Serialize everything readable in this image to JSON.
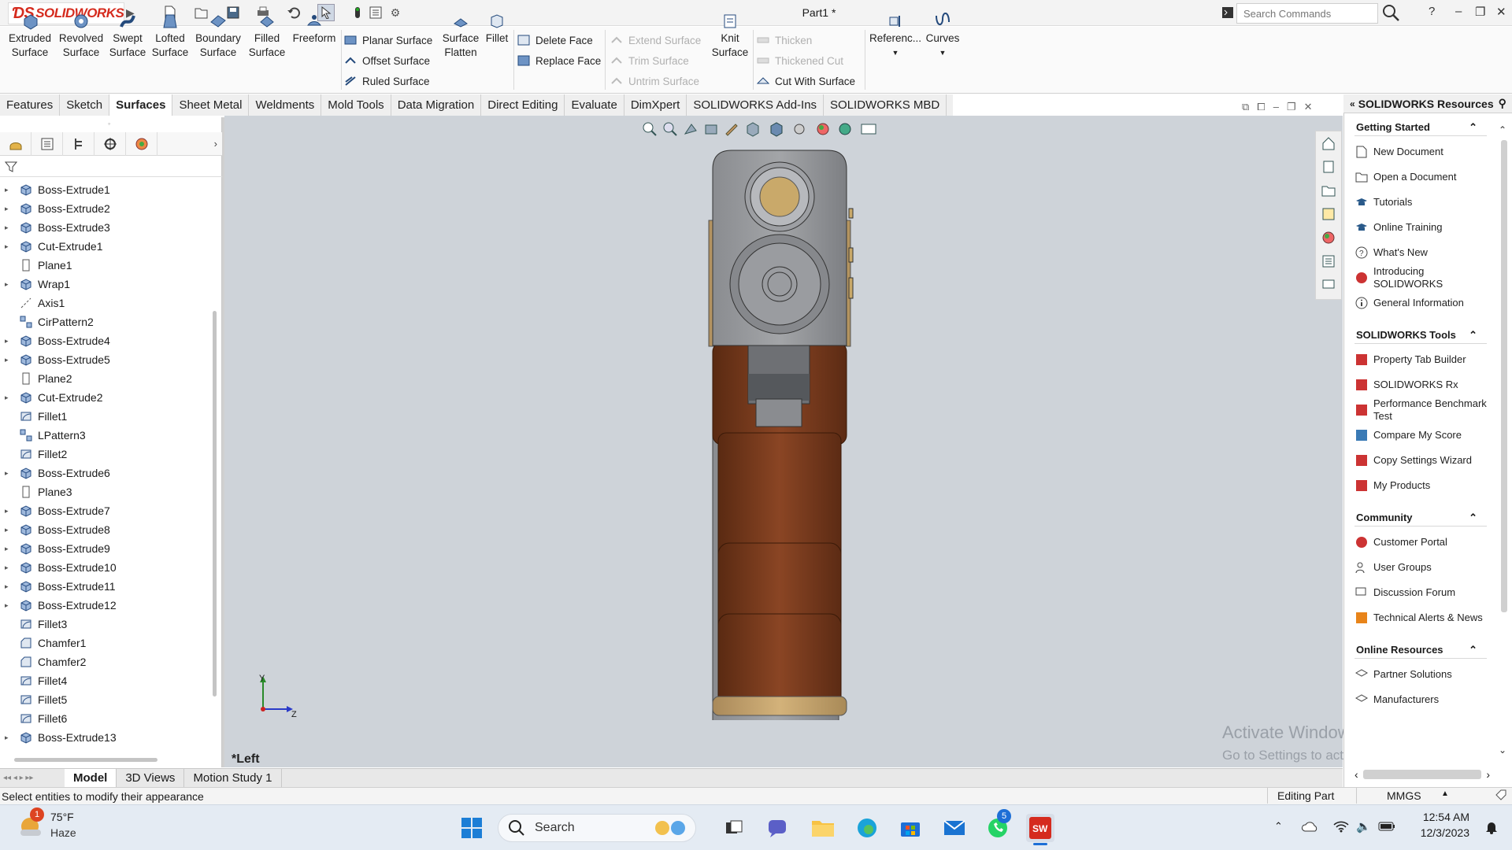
{
  "titlebar": {
    "app_name": "SOLIDWORKS",
    "doc_title": "Part1 *",
    "search_placeholder": "Search Commands",
    "help_label": "?"
  },
  "command_manager": {
    "big_buttons": [
      {
        "label": "Extruded Surface"
      },
      {
        "label": "Revolved Surface"
      },
      {
        "label": "Swept Surface"
      },
      {
        "label": "Lofted Surface"
      },
      {
        "label": "Boundary Surface"
      },
      {
        "label": "Filled Surface"
      },
      {
        "label": "Freeform"
      }
    ],
    "group1": [
      "Planar Surface",
      "Offset Surface",
      "Ruled Surface"
    ],
    "surface_flatten": "Surface Flatten",
    "fillet": "Fillet",
    "group2": [
      "Delete Face",
      "Replace Face"
    ],
    "group3_disabled": [
      "Extend Surface",
      "Trim Surface",
      "Untrim Surface"
    ],
    "knit": "Knit Surface",
    "group4": [
      "Thicken",
      "Thickened Cut",
      "Cut With Surface"
    ],
    "reference": "Referenc...",
    "curves": "Curves",
    "tabs": [
      "Features",
      "Sketch",
      "Surfaces",
      "Sheet Metal",
      "Weldments",
      "Mold Tools",
      "Data Migration",
      "Direct Editing",
      "Evaluate",
      "DimXpert",
      "SOLIDWORKS Add-Ins",
      "SOLIDWORKS MBD"
    ],
    "active_tab": "Surfaces"
  },
  "feature_tree": {
    "items": [
      {
        "name": "Boss-Extrude1",
        "type": "extrude",
        "expandable": true
      },
      {
        "name": "Boss-Extrude2",
        "type": "extrude",
        "expandable": true
      },
      {
        "name": "Boss-Extrude3",
        "type": "extrude",
        "expandable": true
      },
      {
        "name": "Cut-Extrude1",
        "type": "extrude",
        "expandable": true
      },
      {
        "name": "Plane1",
        "type": "plane",
        "expandable": false
      },
      {
        "name": "Wrap1",
        "type": "extrude",
        "expandable": true
      },
      {
        "name": "Axis1",
        "type": "axis",
        "expandable": false
      },
      {
        "name": "CirPattern2",
        "type": "pattern",
        "expandable": false
      },
      {
        "name": "Boss-Extrude4",
        "type": "extrude",
        "expandable": true
      },
      {
        "name": "Boss-Extrude5",
        "type": "extrude",
        "expandable": true
      },
      {
        "name": "Plane2",
        "type": "plane",
        "expandable": false
      },
      {
        "name": "Cut-Extrude2",
        "type": "extrude",
        "expandable": true
      },
      {
        "name": "Fillet1",
        "type": "fillet",
        "expandable": false
      },
      {
        "name": "LPattern3",
        "type": "pattern",
        "expandable": false
      },
      {
        "name": "Fillet2",
        "type": "fillet",
        "expandable": false
      },
      {
        "name": "Boss-Extrude6",
        "type": "extrude",
        "expandable": true
      },
      {
        "name": "Plane3",
        "type": "plane",
        "expandable": false
      },
      {
        "name": "Boss-Extrude7",
        "type": "extrude",
        "expandable": true
      },
      {
        "name": "Boss-Extrude8",
        "type": "extrude",
        "expandable": true
      },
      {
        "name": "Boss-Extrude9",
        "type": "extrude",
        "expandable": true
      },
      {
        "name": "Boss-Extrude10",
        "type": "extrude",
        "expandable": true
      },
      {
        "name": "Boss-Extrude11",
        "type": "extrude",
        "expandable": true
      },
      {
        "name": "Boss-Extrude12",
        "type": "extrude",
        "expandable": true
      },
      {
        "name": "Fillet3",
        "type": "fillet",
        "expandable": false
      },
      {
        "name": "Chamfer1",
        "type": "chamfer",
        "expandable": false
      },
      {
        "name": "Chamfer2",
        "type": "chamfer",
        "expandable": false
      },
      {
        "name": "Fillet4",
        "type": "fillet",
        "expandable": false
      },
      {
        "name": "Fillet5",
        "type": "fillet",
        "expandable": false
      },
      {
        "name": "Fillet6",
        "type": "fillet",
        "expandable": false
      },
      {
        "name": "Boss-Extrude13",
        "type": "extrude",
        "expandable": true
      }
    ]
  },
  "viewport": {
    "view_name": "*Left",
    "triad_y": "Y",
    "triad_z": "Z",
    "colors": {
      "background": "#ced3d9",
      "wood": "#7a3b1f",
      "metal": "#8a8a8a",
      "brass": "#c9a96a"
    }
  },
  "bottom_tabs": {
    "items": [
      "Model",
      "3D Views",
      "Motion Study 1"
    ],
    "active": "Model"
  },
  "statusbar": {
    "message": "Select entities to modify their appearance",
    "mode": "Editing Part",
    "units": "MMGS"
  },
  "taskpane": {
    "title": "SOLIDWORKS Resources",
    "sections": [
      {
        "title": "Getting Started",
        "items": [
          "New Document",
          "Open a Document",
          "Tutorials",
          "Online Training",
          "What's New",
          "Introducing SOLIDWORKS",
          "General Information"
        ]
      },
      {
        "title": "SOLIDWORKS Tools",
        "items": [
          "Property Tab Builder",
          "SOLIDWORKS Rx",
          "Performance Benchmark Test",
          "Compare My Score",
          "Copy Settings Wizard",
          "My Products"
        ]
      },
      {
        "title": "Community",
        "items": [
          "Customer Portal",
          "User Groups",
          "Discussion Forum",
          "Technical Alerts & News"
        ]
      },
      {
        "title": "Online Resources",
        "items": [
          "Partner Solutions",
          "Manufacturers"
        ]
      }
    ]
  },
  "watermark": {
    "line1": "Activate Windows",
    "line2": "Go to Settings to activate Windows."
  },
  "taskbar": {
    "weather_temp": "75°F",
    "weather_desc": "Haze",
    "weather_badge": "1",
    "search_label": "Search",
    "whatsapp_badge": "5",
    "time": "12:54 AM",
    "date": "12/3/2023"
  }
}
